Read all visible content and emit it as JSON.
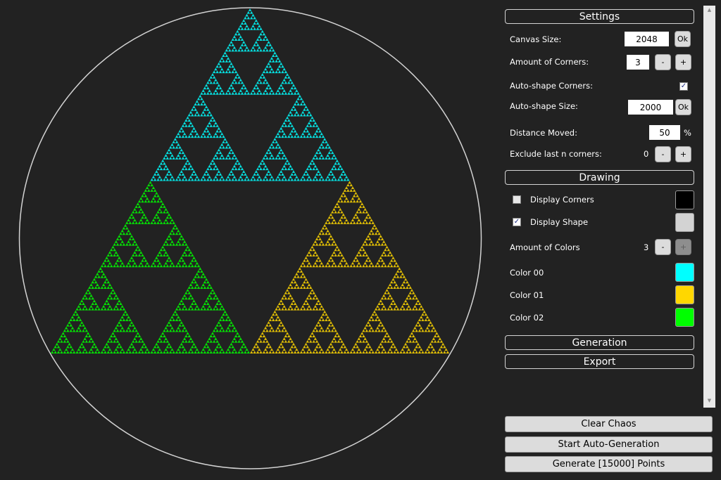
{
  "settings": {
    "header": "Settings",
    "canvas_size_label": "Canvas Size:",
    "canvas_size_value": "2048",
    "canvas_size_ok": "Ok",
    "corners_label": "Amount of Corners:",
    "corners_value": "3",
    "corners_minus": "-",
    "corners_plus": "+",
    "auto_shape_corners_label": "Auto-shape Corners:",
    "auto_shape_corners_checked": true,
    "auto_shape_size_label": "Auto-shape Size:",
    "auto_shape_size_value": "2000",
    "auto_shape_size_ok": "Ok",
    "distance_label": "Distance Moved:",
    "distance_value": "50",
    "distance_unit": "%",
    "exclude_label": "Exclude last n corners:",
    "exclude_value": "0",
    "exclude_minus": "-",
    "exclude_plus": "+"
  },
  "drawing": {
    "header": "Drawing",
    "display_corners_label": "Display Corners",
    "display_corners_checked": false,
    "display_corners_color": "#000000",
    "display_shape_label": "Display Shape",
    "display_shape_checked": true,
    "display_shape_color": "#d3d3d3",
    "colors_label": "Amount of Colors",
    "colors_value": "3",
    "colors_minus": "-",
    "colors_plus": "+",
    "colors": [
      {
        "label": "Color 00",
        "hex": "#00ffff"
      },
      {
        "label": "Color 01",
        "hex": "#ffd700"
      },
      {
        "label": "Color 02",
        "hex": "#00ff00"
      }
    ]
  },
  "generation": {
    "header": "Generation"
  },
  "export": {
    "header": "Export"
  },
  "actions": {
    "clear": "Clear Chaos",
    "auto": "Start Auto-Generation",
    "generate": "Generate [15000] Points"
  },
  "canvas": {
    "shape": "circle",
    "shape_color": "#d3d3d3",
    "background": "#222222",
    "fractal": "sierpinski-triangle",
    "corner_colors": [
      "#00ffff",
      "#ffd700",
      "#00ff00"
    ]
  }
}
